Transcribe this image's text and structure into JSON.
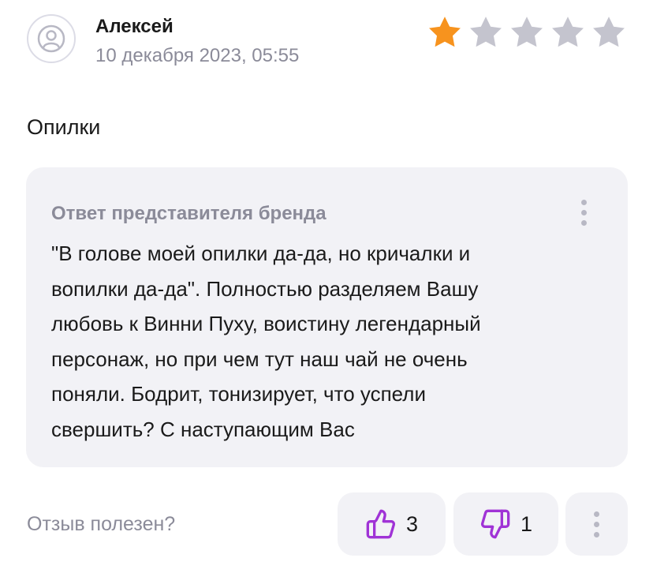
{
  "review": {
    "author": "Алексей",
    "date": "10 декабря 2023, 05:55",
    "rating": 1,
    "max_rating": 5,
    "text": "Опилки"
  },
  "reply": {
    "title": "Ответ представителя бренда",
    "text": "\"В голове моей опилки да-да, но кричалки и\nвопилки да-да\". Полностью разделяем Вашу\nлюбовь к Винни Пуху, воистину легендарный\nперсонаж, но при чем тут наш чай не очень\nпоняли. Бодрит, тонизирует, что успели\nсвершить? С наступающим Вас"
  },
  "feedback": {
    "helpful_label": "Отзыв полезен?",
    "likes": "3",
    "dislikes": "1"
  },
  "icons": {
    "avatar": "user-icon",
    "star": "star-icon",
    "like": "thumbs-up-icon",
    "dislike": "thumbs-down-icon",
    "menu": "more-vertical-icon"
  },
  "colors": {
    "star_filled": "#F7931E",
    "star_empty": "#C4C4CE",
    "accent": "#A033D6",
    "muted_text": "#8B8B99",
    "card_background": "#F2F2F6"
  }
}
